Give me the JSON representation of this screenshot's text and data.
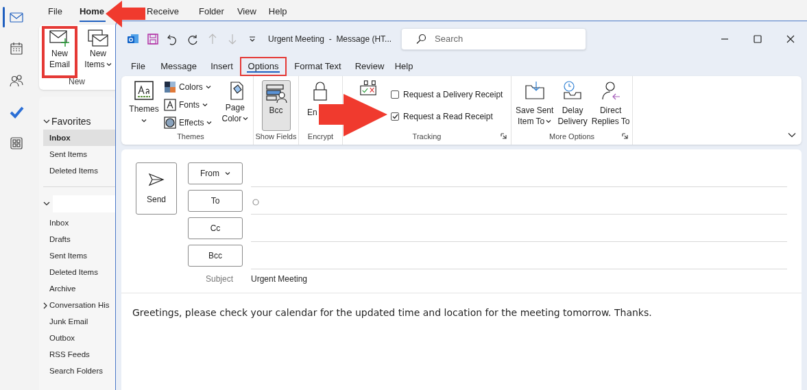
{
  "nav_rail": {
    "items": [
      {
        "kind": "mail",
        "selected": true
      },
      {
        "kind": "calendar",
        "selected": false
      },
      {
        "kind": "people",
        "selected": false
      },
      {
        "kind": "todo",
        "selected": false
      },
      {
        "kind": "apps",
        "selected": false
      }
    ]
  },
  "main_window": {
    "menu_tabs": [
      {
        "label": "File",
        "selected": false
      },
      {
        "label": "Home",
        "selected": true
      },
      {
        "label": "Receive",
        "selected": false
      },
      {
        "label": "Folder",
        "selected": false
      },
      {
        "label": "View",
        "selected": false
      },
      {
        "label": "Help",
        "selected": false
      }
    ],
    "ribbon": {
      "buttons": [
        {
          "kind": "new-email",
          "lines": [
            "New",
            "Email"
          ],
          "dropdown": false,
          "highlighted": true
        },
        {
          "kind": "new-items",
          "lines": [
            "New",
            "Items"
          ],
          "dropdown": true,
          "highlighted": false
        }
      ],
      "group_label": "New"
    },
    "folder_pane": {
      "favorites": {
        "label": "Favorites",
        "expanded": true,
        "items": [
          {
            "label": "Inbox",
            "selected": true
          },
          {
            "label": "Sent Items",
            "selected": false
          },
          {
            "label": "Deleted Items",
            "selected": false
          }
        ]
      },
      "account": {
        "expanded": true,
        "folders": [
          {
            "label": "Inbox",
            "has_children": false
          },
          {
            "label": "Drafts",
            "has_children": false
          },
          {
            "label": "Sent Items",
            "has_children": false
          },
          {
            "label": "Deleted Items",
            "has_children": false
          },
          {
            "label": "Archive",
            "has_children": false
          },
          {
            "label": "Conversation His",
            "has_children": true
          },
          {
            "label": "Junk Email",
            "has_children": false
          },
          {
            "label": "Outbox",
            "has_children": false
          },
          {
            "label": "RSS Feeds",
            "has_children": false
          },
          {
            "label": "Search Folders",
            "has_children": false
          }
        ]
      }
    }
  },
  "message_window": {
    "title": "Urgent Meeting  -  Message (HT...",
    "search": {
      "placeholder": "Search"
    },
    "tabs": [
      {
        "label": "File",
        "selected": false,
        "highlighted": false
      },
      {
        "label": "Message",
        "selected": false,
        "highlighted": false
      },
      {
        "label": "Insert",
        "selected": false,
        "highlighted": false
      },
      {
        "label": "Options",
        "selected": true,
        "highlighted": true
      },
      {
        "label": "Format Text",
        "selected": false,
        "highlighted": false
      },
      {
        "label": "Review",
        "selected": false,
        "highlighted": false
      },
      {
        "label": "Help",
        "selected": false,
        "highlighted": false
      }
    ],
    "ribbon": {
      "themes": {
        "label": "Themes",
        "themes_button": "Themes",
        "small_buttons": [
          {
            "kind": "colors",
            "label": "Colors"
          },
          {
            "kind": "fonts",
            "label": "Fonts"
          },
          {
            "kind": "effects",
            "label": "Effects"
          }
        ],
        "page_color": [
          "Page",
          "Color"
        ]
      },
      "show_fields": {
        "label": "Show Fields",
        "bcc": {
          "label": "Bcc",
          "selected": true
        }
      },
      "encrypt": {
        "label": "Encrypt",
        "button": "En"
      },
      "tracking": {
        "label": "Tracking",
        "checkboxes": [
          {
            "label": "Request a Delivery Receipt",
            "checked": false
          },
          {
            "label": "Request a Read Receipt",
            "checked": true
          }
        ]
      },
      "more_options": {
        "label": "More Options",
        "buttons": [
          {
            "kind": "save-sent",
            "lines": [
              "Save Sent",
              "Item To"
            ],
            "dropdown": true
          },
          {
            "kind": "delay",
            "lines": [
              "Delay",
              "Delivery"
            ],
            "dropdown": false
          },
          {
            "kind": "replies",
            "lines": [
              "Direct",
              "Replies To"
            ],
            "dropdown": false
          }
        ]
      }
    },
    "compose": {
      "send": "Send",
      "address_buttons": [
        {
          "label": "From",
          "dropdown": true
        },
        {
          "label": "To",
          "dropdown": false
        },
        {
          "label": "Cc",
          "dropdown": false
        },
        {
          "label": "Bcc",
          "dropdown": false
        }
      ],
      "subject_label": "Subject",
      "subject": "Urgent Meeting",
      "body": "Greetings, please check your calendar for the updated time and location for the meeting tomorrow. Thanks."
    }
  }
}
